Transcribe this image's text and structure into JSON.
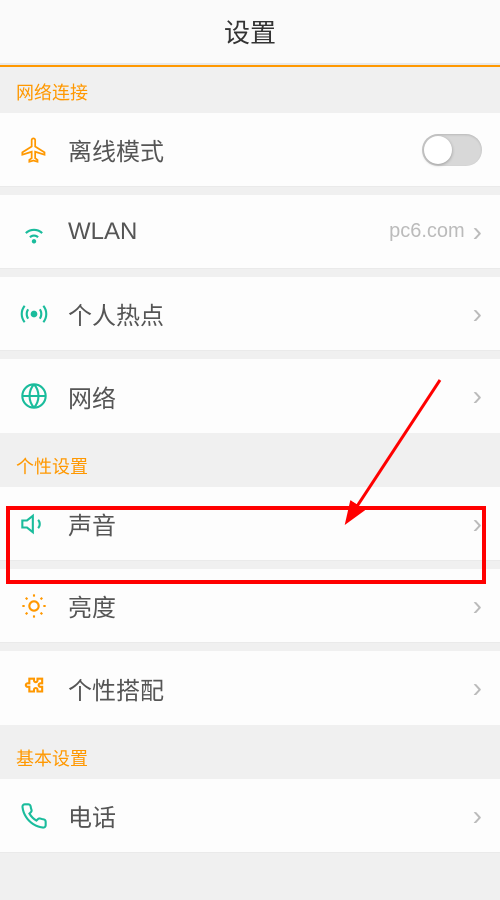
{
  "header": {
    "title": "设置"
  },
  "sections": {
    "network": {
      "label": "网络连接",
      "items": {
        "airplane": "离线模式",
        "wlan": "WLAN",
        "wlan_value": "pc6.com",
        "hotspot": "个人热点",
        "network": "网络"
      }
    },
    "personal": {
      "label": "个性设置",
      "items": {
        "sound": "声音",
        "brightness": "亮度",
        "theme": "个性搭配"
      }
    },
    "basic": {
      "label": "基本设置",
      "items": {
        "phone": "电话"
      }
    }
  }
}
